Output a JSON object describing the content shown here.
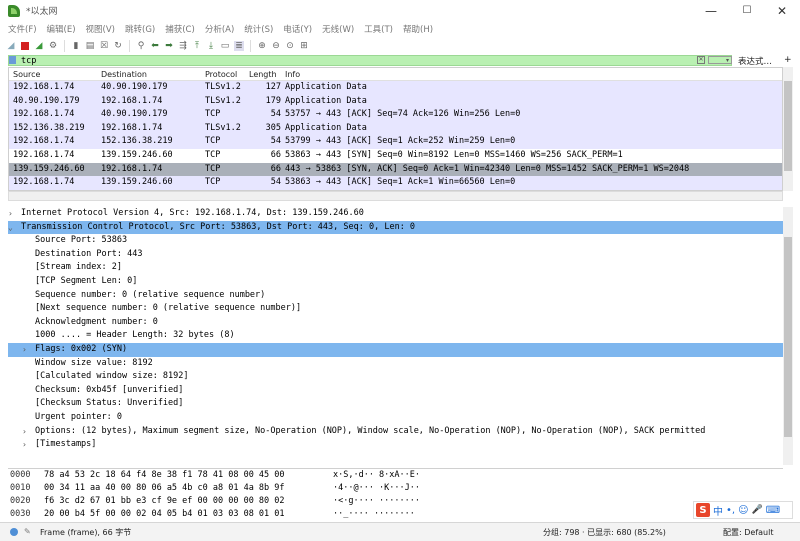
{
  "window": {
    "title": "*以太网",
    "minimize": "—",
    "maximize": "☐",
    "close": "✕"
  },
  "menu": [
    "文件(F)",
    "编辑(E)",
    "视图(V)",
    "跳转(G)",
    "捕获(C)",
    "分析(A)",
    "统计(S)",
    "电话(Y)",
    "无线(W)",
    "工具(T)",
    "帮助(H)"
  ],
  "filter": {
    "value": "tcp",
    "expression_label": "表达式…",
    "plus": "+"
  },
  "packet_list": {
    "columns": [
      "Source",
      "Destination",
      "Protocol",
      "Length",
      "Info"
    ],
    "rows": [
      {
        "src": "192.168.1.74",
        "dst": "40.90.190.179",
        "proto": "TLSv1.2",
        "len": "127",
        "info": "Application Data",
        "style": "lav"
      },
      {
        "src": "40.90.190.179",
        "dst": "192.168.1.74",
        "proto": "TLSv1.2",
        "len": "179",
        "info": "Application Data",
        "style": "lav"
      },
      {
        "src": "192.168.1.74",
        "dst": "40.90.190.179",
        "proto": "TCP",
        "len": "54",
        "info": "53757 → 443 [ACK] Seq=74 Ack=126 Win=256 Len=0",
        "style": "lav"
      },
      {
        "src": "152.136.38.219",
        "dst": "192.168.1.74",
        "proto": "TLSv1.2",
        "len": "305",
        "info": "Application Data",
        "style": "lav"
      },
      {
        "src": "192.168.1.74",
        "dst": "152.136.38.219",
        "proto": "TCP",
        "len": "54",
        "info": "53799 → 443 [ACK] Seq=1 Ack=252 Win=259 Len=0",
        "style": "lav"
      },
      {
        "src": "192.168.1.74",
        "dst": "139.159.246.60",
        "proto": "TCP",
        "len": "66",
        "info": "53863 → 443 [SYN] Seq=0 Win=8192 Len=0 MSS=1460 WS=256 SACK_PERM=1",
        "style": "white"
      },
      {
        "src": "139.159.246.60",
        "dst": "192.168.1.74",
        "proto": "TCP",
        "len": "66",
        "info": "443 → 53863 [SYN, ACK] Seq=0 Ack=1 Win=42340 Len=0 MSS=1452 SACK_PERM=1 WS=2048",
        "style": "sel"
      },
      {
        "src": "192.168.1.74",
        "dst": "139.159.246.60",
        "proto": "TCP",
        "len": "54",
        "info": "53863 → 443 [ACK] Seq=1 Ack=1 Win=66560 Len=0",
        "style": "lav"
      }
    ]
  },
  "details": [
    {
      "indent": 0,
      "twisty": "›",
      "text": "Internet Protocol Version 4, Src: 192.168.1.74, Dst: 139.159.246.60",
      "sel": false
    },
    {
      "indent": 0,
      "twisty": "⌄",
      "text": "Transmission Control Protocol, Src Port: 53863, Dst Port: 443, Seq: 0, Len: 0",
      "sel": true
    },
    {
      "indent": 1,
      "twisty": "",
      "text": "Source Port: 53863",
      "sel": false
    },
    {
      "indent": 1,
      "twisty": "",
      "text": "Destination Port: 443",
      "sel": false
    },
    {
      "indent": 1,
      "twisty": "",
      "text": "[Stream index: 2]",
      "sel": false
    },
    {
      "indent": 1,
      "twisty": "",
      "text": "[TCP Segment Len: 0]",
      "sel": false
    },
    {
      "indent": 1,
      "twisty": "",
      "text": "Sequence number: 0    (relative sequence number)",
      "sel": false
    },
    {
      "indent": 1,
      "twisty": "",
      "text": "[Next sequence number: 0    (relative sequence number)]",
      "sel": false
    },
    {
      "indent": 1,
      "twisty": "",
      "text": "Acknowledgment number: 0",
      "sel": false
    },
    {
      "indent": 1,
      "twisty": "",
      "text": "1000 .... = Header Length: 32 bytes (8)",
      "sel": false
    },
    {
      "indent": 1,
      "twisty": "›",
      "text": "Flags: 0x002 (SYN)",
      "sel": true
    },
    {
      "indent": 1,
      "twisty": "",
      "text": "Window size value: 8192",
      "sel": false
    },
    {
      "indent": 1,
      "twisty": "",
      "text": "[Calculated window size: 8192]",
      "sel": false
    },
    {
      "indent": 1,
      "twisty": "",
      "text": "Checksum: 0xb45f [unverified]",
      "sel": false
    },
    {
      "indent": 1,
      "twisty": "",
      "text": "[Checksum Status: Unverified]",
      "sel": false
    },
    {
      "indent": 1,
      "twisty": "",
      "text": "Urgent pointer: 0",
      "sel": false
    },
    {
      "indent": 1,
      "twisty": "›",
      "text": "Options: (12 bytes), Maximum segment size, No-Operation (NOP), Window scale, No-Operation (NOP), No-Operation (NOP), SACK permitted",
      "sel": false
    },
    {
      "indent": 1,
      "twisty": "›",
      "text": "[Timestamps]",
      "sel": false
    }
  ],
  "hex": [
    {
      "off": "0000",
      "bytes": "78 a4 53 2c 18 64 f4 8e  38 f1 78 41 08 00 45 00",
      "ascii": "x·S,·d·· 8·xA··E·"
    },
    {
      "off": "0010",
      "bytes": "00 34 11 aa 40 00 80 06  a5 4b c0 a8 01 4a 8b 9f",
      "ascii": "·4··@··· ·K···J··"
    },
    {
      "off": "0020",
      "bytes": "f6 3c d2 67 01 bb e3 cf  9e ef 00 00 00 00 80 02",
      "ascii": "·<·g···· ········"
    },
    {
      "off": "0030",
      "bytes": "20 00 b4 5f 00 00 02 04  05 b4 01 03 03 08 01 01",
      "ascii": " ··_···· ········"
    }
  ],
  "status": {
    "frame": "Frame (frame), 66 字节",
    "packets": "分组: 798 · 已显示: 680 (85.2%)",
    "profile": "配置: Default"
  },
  "ime": {
    "logo": "S",
    "lang": "中",
    "punct": "•,",
    "emoji": "☺",
    "voice": "🎤",
    "keyboard": "⌨"
  },
  "colors": {
    "filter_bg": "#b9f0b2",
    "row_lavender": "#e7e6ff",
    "row_selected": "#aab0b9",
    "detail_selected": "#7eb6ee"
  }
}
